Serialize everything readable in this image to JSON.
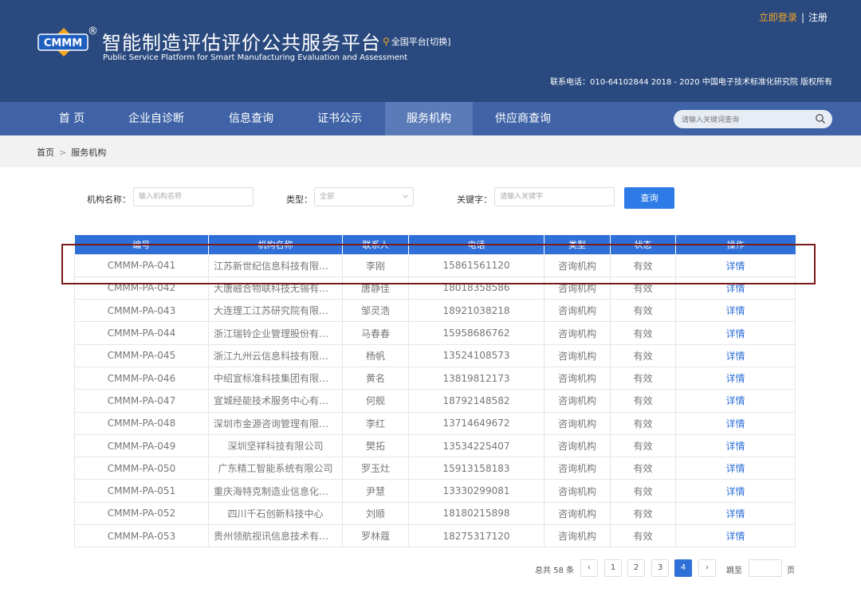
{
  "header": {
    "logo_text": "CMMM",
    "registered_mark": "®",
    "title": "智能制造评估评价公共服务平台",
    "subtitle": "Public Service Platform for Smart Manufacturing Evaluation and Assessment",
    "region_label": "全国平台[切换]",
    "login_label": "立即登录",
    "separator": "|",
    "register_label": "注册",
    "contact": "联系电话：010-64102844  2018 - 2020 中国电子技术标准化研究院 版权所有"
  },
  "nav": {
    "items": [
      {
        "label": "首 页",
        "active": false
      },
      {
        "label": "企业自诊断",
        "active": false
      },
      {
        "label": "信息查询",
        "active": false
      },
      {
        "label": "证书公示",
        "active": false
      },
      {
        "label": "服务机构",
        "active": true
      },
      {
        "label": "供应商查询",
        "active": false
      }
    ],
    "search_placeholder": "请输入关键词查询"
  },
  "breadcrumb": {
    "home": "首页",
    "sep": ">",
    "current": "服务机构"
  },
  "filters": {
    "name_label": "机构名称：",
    "name_placeholder": "输入机构名称",
    "type_label": "类型：",
    "type_value": "全部",
    "keyword_label": "关键字：",
    "keyword_placeholder": "请输入关键字",
    "query_button": "查询"
  },
  "table": {
    "columns": [
      "编号",
      "机构名称",
      "联系人",
      "电话",
      "类型",
      "状态",
      "操作"
    ],
    "rows": [
      [
        "CMMM-PA-041",
        "江苏新世纪信息科技有限公...",
        "李刚",
        "15861561120",
        "咨询机构",
        "有效",
        "详情"
      ],
      [
        "CMMM-PA-042",
        "大唐融合物联科技无锡有限...",
        "唐静佳",
        "18018358586",
        "咨询机构",
        "有效",
        "详情"
      ],
      [
        "CMMM-PA-043",
        "大连理工江苏研究院有限公...",
        "邹灵浩",
        "18921038218",
        "咨询机构",
        "有效",
        "详情"
      ],
      [
        "CMMM-PA-044",
        "浙江瑞铃企业管理股份有限...",
        "马春春",
        "15958686762",
        "咨询机构",
        "有效",
        "详情"
      ],
      [
        "CMMM-PA-045",
        "浙江九州云信息科技有限公...",
        "杨帆",
        "13524108573",
        "咨询机构",
        "有效",
        "详情"
      ],
      [
        "CMMM-PA-046",
        "中绍宣标准科技集团有限公...",
        "黄名",
        "13819812173",
        "咨询机构",
        "有效",
        "详情"
      ],
      [
        "CMMM-PA-047",
        "宣城经能技术服务中心有限...",
        "何舰",
        "18792148582",
        "咨询机构",
        "有效",
        "详情"
      ],
      [
        "CMMM-PA-048",
        "深圳市金源咨询管理有限公...",
        "李红",
        "13714649672",
        "咨询机构",
        "有效",
        "详情"
      ],
      [
        "CMMM-PA-049",
        "深圳坚祥科技有限公司",
        "樊拓",
        "13534225407",
        "咨询机构",
        "有效",
        "详情"
      ],
      [
        "CMMM-PA-050",
        "广东精工智能系统有限公司",
        "罗玉灶",
        "15913158183",
        "咨询机构",
        "有效",
        "详情"
      ],
      [
        "CMMM-PA-051",
        "重庆海特克制造业信息化生...",
        "尹慧",
        "13330299081",
        "咨询机构",
        "有效",
        "详情"
      ],
      [
        "CMMM-PA-052",
        "四川千石创新科技中心",
        "刘顺",
        "18180215898",
        "咨询机构",
        "有效",
        "详情"
      ],
      [
        "CMMM-PA-053",
        "贵州领航视讯信息技术有限...",
        "罗林蔻",
        "18275317120",
        "咨询机构",
        "有效",
        "详情"
      ]
    ]
  },
  "pagination": {
    "total": "总共 58 条",
    "prev": "‹",
    "pages": [
      "1",
      "2",
      "3",
      "4"
    ],
    "current": "4",
    "next": "›",
    "jump_label": "跳至",
    "unit": "页"
  },
  "colors": {
    "header_bg": "#2a4a7f",
    "nav_bg": "#3f63a6",
    "accent": "#2e6fd8",
    "login": "#f5a623",
    "highlight": "#7a1a1a"
  }
}
